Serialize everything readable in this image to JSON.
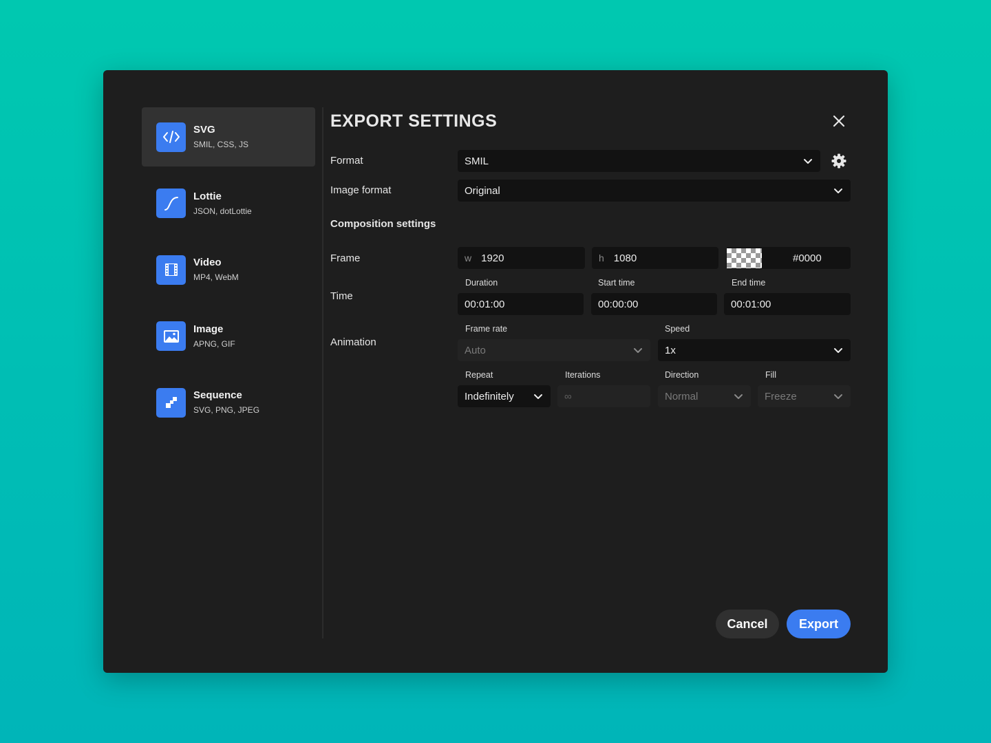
{
  "sidebar": {
    "items": [
      {
        "title": "SVG",
        "subtitle": "SMIL, CSS, JS",
        "icon": "code-icon",
        "active": true
      },
      {
        "title": "Lottie",
        "subtitle": "JSON, dotLottie",
        "icon": "curve-icon"
      },
      {
        "title": "Video",
        "subtitle": "MP4, WebM",
        "icon": "film-icon"
      },
      {
        "title": "Image",
        "subtitle": "APNG, GIF",
        "icon": "image-icon"
      },
      {
        "title": "Sequence",
        "subtitle": "SVG, PNG, JPEG",
        "icon": "sequence-icon"
      }
    ]
  },
  "header": {
    "title": "EXPORT SETTINGS"
  },
  "format": {
    "label": "Format",
    "value": "SMIL"
  },
  "image_format": {
    "label": "Image format",
    "value": "Original"
  },
  "composition": {
    "heading": "Composition settings"
  },
  "frame": {
    "label": "Frame",
    "w_prefix": "w",
    "width": "1920",
    "h_prefix": "h",
    "height": "1080",
    "color": "#0000"
  },
  "time": {
    "label": "Time",
    "duration_label": "Duration",
    "duration": "00:01:00",
    "start_label": "Start time",
    "start": "00:00:00",
    "end_label": "End time",
    "end": "00:01:00"
  },
  "animation": {
    "label": "Animation",
    "frame_rate_label": "Frame rate",
    "frame_rate": "Auto",
    "speed_label": "Speed",
    "speed": "1x",
    "repeat_label": "Repeat",
    "repeat": "Indefinitely",
    "iterations_label": "Iterations",
    "iterations": "∞",
    "direction_label": "Direction",
    "direction": "Normal",
    "fill_label": "Fill",
    "fill": "Freeze"
  },
  "footer": {
    "cancel": "Cancel",
    "export": "Export"
  },
  "colors": {
    "accent": "#3b7cf0",
    "dialog_bg": "#1e1e1e",
    "field_bg": "#121212",
    "background": "#00c2b2"
  }
}
